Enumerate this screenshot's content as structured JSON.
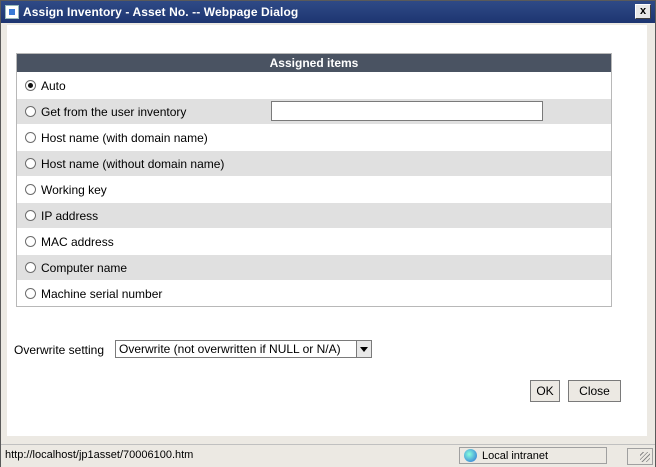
{
  "window": {
    "title": "Assign Inventory - Asset No. -- Webpage Dialog",
    "close_glyph": "x"
  },
  "table": {
    "header": "Assigned items",
    "rows": [
      {
        "label": "Auto",
        "checked": true
      },
      {
        "label": "Get from the user inventory",
        "checked": false,
        "input_value": ""
      },
      {
        "label": "Host name (with domain name)",
        "checked": false
      },
      {
        "label": "Host name (without domain name)",
        "checked": false
      },
      {
        "label": "Working key",
        "checked": false
      },
      {
        "label": "IP address",
        "checked": false
      },
      {
        "label": "MAC address",
        "checked": false
      },
      {
        "label": "Computer name",
        "checked": false
      },
      {
        "label": "Machine serial number",
        "checked": false
      }
    ]
  },
  "overwrite": {
    "label": "Overwrite setting",
    "selected": "Overwrite (not overwritten if NULL or N/A)"
  },
  "buttons": {
    "ok": "OK",
    "close": "Close"
  },
  "status": {
    "url": "http://localhost/jp1asset/70006100.htm",
    "zone": "Local intranet"
  }
}
